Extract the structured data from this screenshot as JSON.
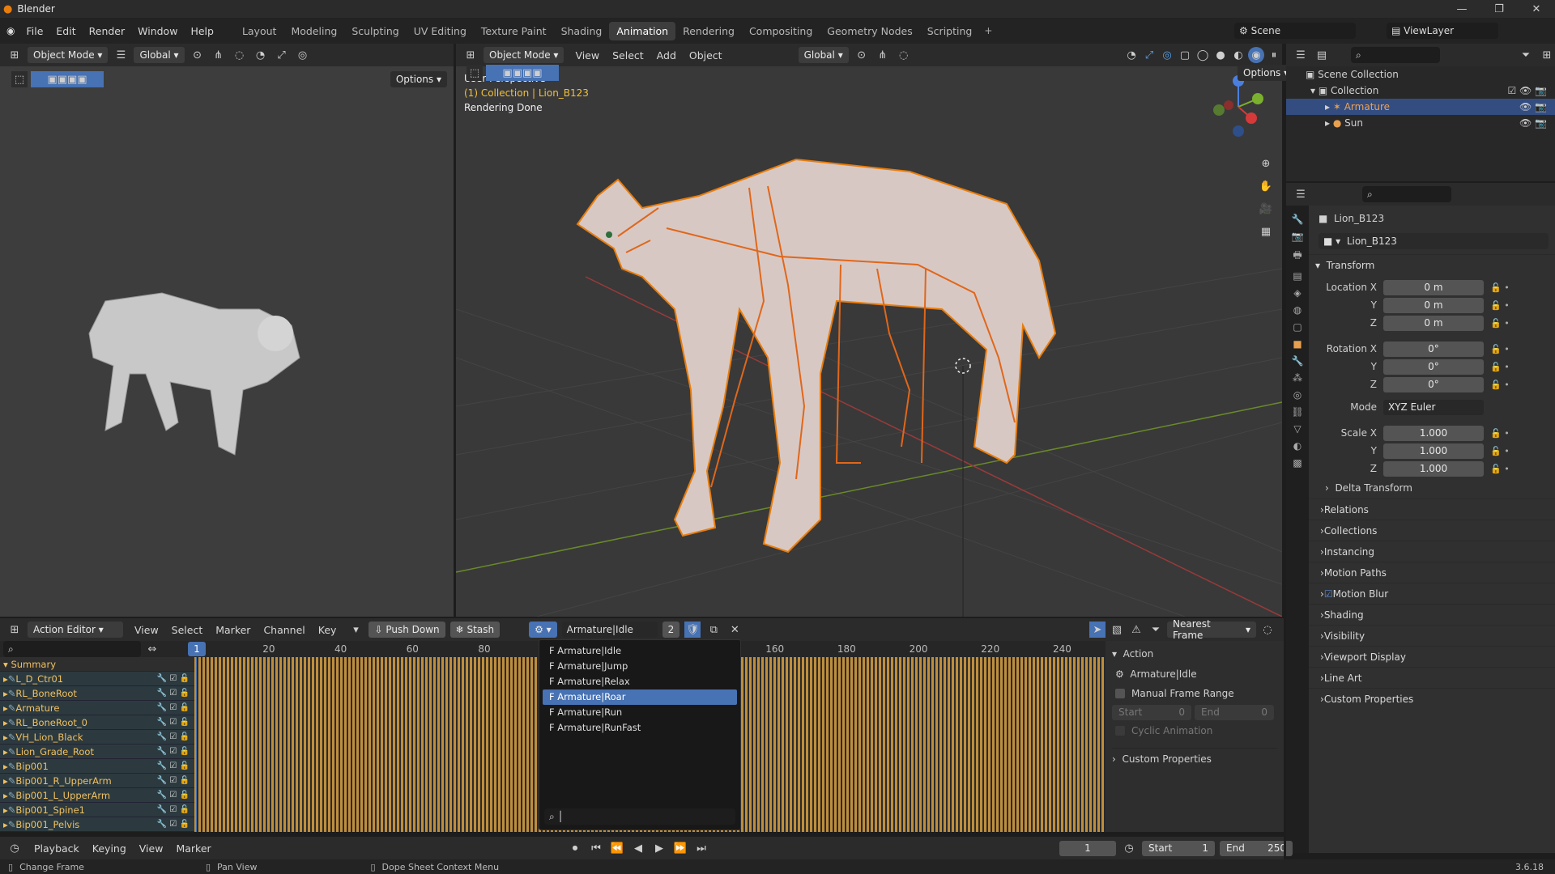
{
  "window": {
    "title": "Blender",
    "version": "3.6.18"
  },
  "menus": [
    "File",
    "Edit",
    "Render",
    "Window",
    "Help"
  ],
  "workspaces": [
    "Layout",
    "Modeling",
    "Sculpting",
    "UV Editing",
    "Texture Paint",
    "Shading",
    "Animation",
    "Rendering",
    "Compositing",
    "Geometry Nodes",
    "Scripting"
  ],
  "active_workspace": "Animation",
  "scene": {
    "name": "Scene",
    "view_layer": "ViewLayer"
  },
  "left_view": {
    "mode": "Object Mode",
    "orientation": "Global",
    "options": "Options"
  },
  "viewport": {
    "mode": "Object Mode",
    "menus": [
      "View",
      "Select",
      "Add",
      "Object"
    ],
    "orientation": "Global",
    "options": "Options",
    "overlay_lines": [
      "User Perspective",
      "(1) Collection | Lion_B123",
      "Rendering Done"
    ]
  },
  "outliner": {
    "root": "Scene Collection",
    "collection": "Collection",
    "items": [
      {
        "name": "Armature"
      },
      {
        "name": "Sun"
      }
    ]
  },
  "properties": {
    "object_name": "Lion_B123",
    "data_name": "Lion_B123",
    "transform_title": "Transform",
    "location": [
      {
        "axis": "Location X",
        "value": "0 m"
      },
      {
        "axis": "Y",
        "value": "0 m"
      },
      {
        "axis": "Z",
        "value": "0 m"
      }
    ],
    "rotation": [
      {
        "axis": "Rotation X",
        "value": "0°"
      },
      {
        "axis": "Y",
        "value": "0°"
      },
      {
        "axis": "Z",
        "value": "0°"
      }
    ],
    "mode_label": "Mode",
    "mode_value": "XYZ Euler",
    "scale": [
      {
        "axis": "Scale X",
        "value": "1.000"
      },
      {
        "axis": "Y",
        "value": "1.000"
      },
      {
        "axis": "Z",
        "value": "1.000"
      }
    ],
    "delta": "Delta Transform",
    "sections": [
      "Relations",
      "Collections",
      "Instancing",
      "Motion Paths",
      "Motion Blur",
      "Shading",
      "Visibility",
      "Viewport Display",
      "Line Art",
      "Custom Properties"
    ]
  },
  "action_editor": {
    "mode": "Action Editor",
    "menus": [
      "View",
      "Select",
      "Marker",
      "Channel",
      "Key"
    ],
    "push_down": "Push Down",
    "stash": "Stash",
    "action": "Armature|Idle",
    "users": "2",
    "snap": "Nearest Frame",
    "current_frame": "1",
    "ruler": [
      "20",
      "40",
      "60",
      "80",
      "160",
      "180",
      "200",
      "220",
      "240"
    ],
    "summary": "Summary",
    "channels": [
      "L_D_Ctr01",
      "RL_BoneRoot",
      "Armature",
      "RL_BoneRoot_0",
      "VH_Lion_Black",
      "Lion_Grade_Root",
      "Bip001",
      "Bip001_R_UpperArm",
      "Bip001_L_UpperArm",
      "Bip001_Spine1",
      "Bip001_Pelvis"
    ],
    "dropdown_items": [
      "F Armature|Idle",
      "F Armature|Jump",
      "F Armature|Relax",
      "F Armature|Roar",
      "F Armature|Run",
      "F Armature|RunFast"
    ],
    "dropdown_selected": "F Armature|Roar",
    "side_panel": {
      "title": "Action",
      "action": "Armature|Idle",
      "manual_range": "Manual Frame Range",
      "start_label": "Start",
      "start_value": "0",
      "end_label": "End",
      "end_value": "0",
      "cyclic": "Cyclic Animation",
      "custom": "Custom Properties"
    }
  },
  "timeline": {
    "menus": [
      "Playback",
      "Keying",
      "View",
      "Marker"
    ],
    "frame": "1",
    "start_label": "Start",
    "start": "1",
    "end_label": "End",
    "end": "250"
  },
  "status": [
    "Change Frame",
    "Pan View",
    "Dope Sheet Context Menu"
  ]
}
